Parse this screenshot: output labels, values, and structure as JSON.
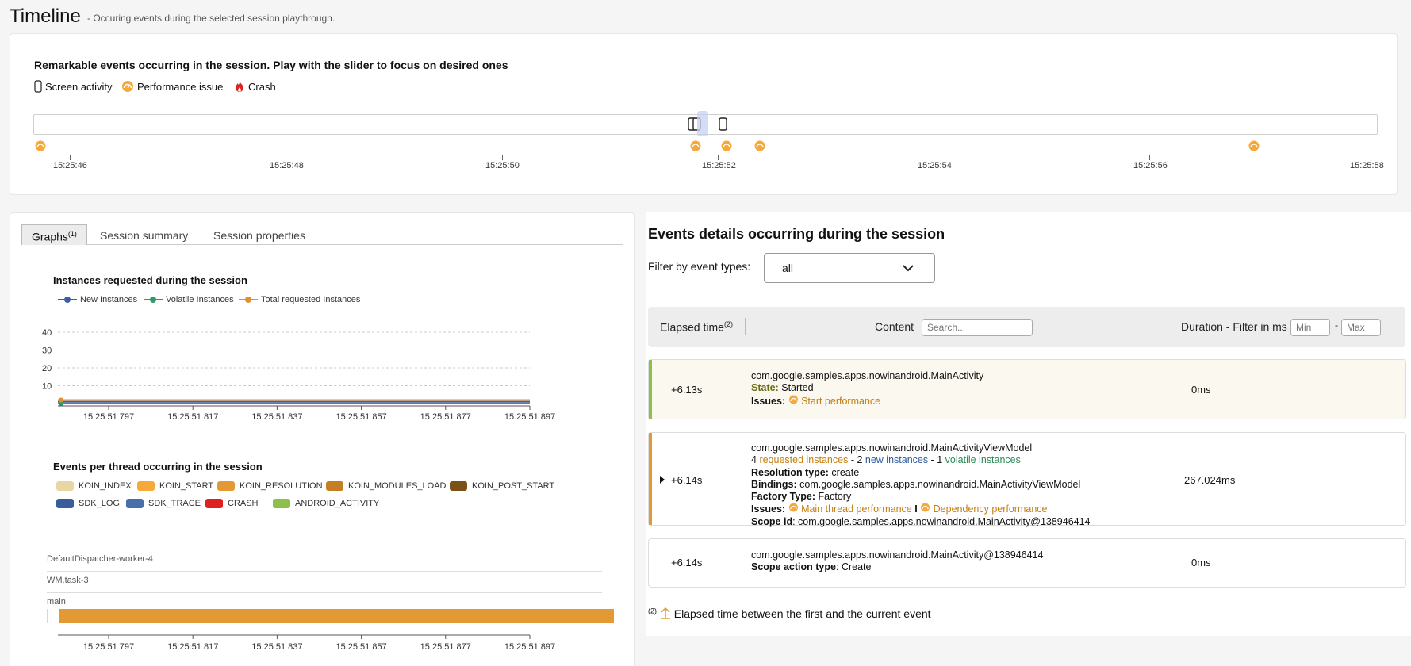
{
  "header": {
    "title": "Timeline",
    "subtitle": "- Occuring events during the selected session playthrough."
  },
  "timeline": {
    "heading": "Remarkable events occurring in the session. Play with the slider to focus on desired ones",
    "legend": {
      "screen_activity": "Screen activity",
      "performance_issue": "Performance issue",
      "crash": "Crash"
    },
    "ticks": [
      "15:25:46",
      "15:25:48",
      "15:25:50",
      "15:25:52",
      "15:25:54",
      "15:25:56",
      "15:25:58"
    ]
  },
  "tabs": {
    "graphs": "Graphs",
    "graphs_sup": "(1)",
    "summary": "Session summary",
    "properties": "Session properties"
  },
  "instances_chart": {
    "title": "Instances requested during the session",
    "legend": {
      "new": "New Instances",
      "volatile": "Volatile Instances",
      "total": "Total requested Instances"
    },
    "y_ticks": [
      "40",
      "30",
      "20",
      "10"
    ],
    "x_ticks": [
      "15:25:51 797",
      "15:25:51 817",
      "15:25:51 837",
      "15:25:51 857",
      "15:25:51 877",
      "15:25:51 897"
    ]
  },
  "chart_data": [
    {
      "type": "line",
      "title": "Instances requested during the session",
      "x": [
        "15:25:51 797",
        "15:25:51 817",
        "15:25:51 837",
        "15:25:51 857",
        "15:25:51 877",
        "15:25:51 897"
      ],
      "ylim": [
        0,
        40
      ],
      "series": [
        {
          "name": "New Instances",
          "color": "#3d5f9e",
          "values": [
            1,
            1,
            1,
            1,
            1,
            1
          ]
        },
        {
          "name": "Volatile Instances",
          "color": "#2e9a6b",
          "values": [
            0,
            0,
            0,
            0,
            0,
            0
          ]
        },
        {
          "name": "Total requested Instances",
          "color": "#e58f2a",
          "values": [
            2,
            2,
            2,
            2,
            2,
            2
          ]
        }
      ]
    }
  ],
  "threads_chart": {
    "title": "Events per thread occurring in the session",
    "legend": [
      {
        "label": "KOIN_INDEX",
        "color": "#e8d6a4"
      },
      {
        "label": "KOIN_START",
        "color": "#f5a93b"
      },
      {
        "label": "KOIN_RESOLUTION",
        "color": "#e49a34"
      },
      {
        "label": "KOIN_MODULES_LOAD",
        "color": "#c47e23"
      },
      {
        "label": "KOIN_POST_START",
        "color": "#7a5216"
      },
      {
        "label": "SDK_LOG",
        "color": "#3a5e99"
      },
      {
        "label": "SDK_TRACE",
        "color": "#4a6ea8"
      },
      {
        "label": "CRASH",
        "color": "#e02020"
      },
      {
        "label": "ANDROID_ACTIVITY",
        "color": "#8cc04a"
      }
    ],
    "threads": [
      "DefaultDispatcher-worker-4",
      "WM.task-3",
      "main"
    ],
    "x_ticks": [
      "15:25:51 797",
      "15:25:51 817",
      "15:25:51 837",
      "15:25:51 857",
      "15:25:51 877",
      "15:25:51 897"
    ]
  },
  "events_panel": {
    "title": "Events details occurring during the session",
    "filter_label": "Filter by event types:",
    "filter_value": "all",
    "headers": {
      "elapsed": "Elapsed time",
      "elapsed_sup": "(2)",
      "content": "Content",
      "search_placeholder": "Search...",
      "duration": "Duration - Filter in ms",
      "min_placeholder": "Min",
      "dash": "-",
      "max_placeholder": "Max"
    },
    "rows": [
      {
        "elapsed": "+6.13s",
        "name": "com.google.samples.apps.nowinandroid.MainActivity",
        "state_label": "State",
        "state_value": "Started",
        "issues_label": "Issues:",
        "issue_1": "Start performance",
        "duration": "0ms"
      },
      {
        "elapsed": "+6.14s",
        "name": "com.google.samples.apps.nowinandroid.MainActivityViewModel",
        "requested_count": "4",
        "requested_label": "requested instances",
        "sep1": "- 2",
        "new_label": "new instances",
        "sep2": "- 1",
        "volatile_label": "volatile instances",
        "resolution_label": "Resolution type:",
        "resolution_value": "create",
        "bindings_label": "Bindings:",
        "bindings_value": "com.google.samples.apps.nowinandroid.MainActivityViewModel",
        "factory_label": "Factory Type:",
        "factory_value": "Factory",
        "issues_label": "Issues:",
        "issue_1": "Main thread performance",
        "issue_sep": "I",
        "issue_2": "Dependency performance",
        "scope_label": "Scope id",
        "scope_value": "com.google.samples.apps.nowinandroid.MainActivity@138946414",
        "duration": "267.024ms"
      },
      {
        "elapsed": "+6.14s",
        "name": "com.google.samples.apps.nowinandroid.MainActivity@138946414",
        "action_label": "Scope action type",
        "action_value": "Create",
        "duration": "0ms"
      }
    ],
    "footnote_sup": "(2)",
    "footnote": "Elapsed time between the first and the current event"
  }
}
